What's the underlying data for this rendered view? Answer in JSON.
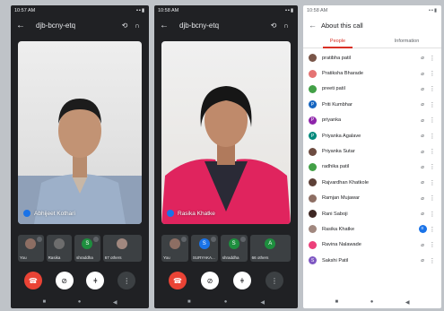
{
  "phone1": {
    "status_time": "10:57 AM",
    "meeting_code": "djb-bcny-etq",
    "speaker": "Abhijeet Kothari",
    "tiles": [
      {
        "label": "You",
        "initial": "",
        "color": "#8d6e63"
      },
      {
        "label": "Rasika",
        "initial": "",
        "color": "#6d6d6d"
      },
      {
        "label": "shraddha",
        "initial": "S",
        "color": "#1e8e3e"
      },
      {
        "label": "67 others",
        "initial": "",
        "color": "#a1887f"
      }
    ]
  },
  "phone2": {
    "status_time": "10:58 AM",
    "meeting_code": "djb-bcny-etq",
    "speaker": "Rasika Khatke",
    "tiles": [
      {
        "label": "You",
        "initial": "",
        "color": "#8d6e63"
      },
      {
        "label": "SURYAKA...",
        "initial": "S",
        "color": "#1a73e8"
      },
      {
        "label": "shraddha",
        "initial": "S",
        "color": "#1e8e3e"
      },
      {
        "label": "66 others",
        "initial": "A",
        "color": "#1e8e3e"
      }
    ]
  },
  "panel": {
    "status_time": "10:58 AM",
    "title": "About this call",
    "tabs": [
      "People",
      "Information"
    ],
    "participants": [
      {
        "name": "pratibha patil",
        "initial": "",
        "color": "#795548",
        "speaking": false
      },
      {
        "name": "Pratiksha Bharade",
        "initial": "",
        "color": "#e57373",
        "speaking": false
      },
      {
        "name": "preeti patil",
        "initial": "",
        "color": "#43a047",
        "speaking": false
      },
      {
        "name": "Priti Kumbhar",
        "initial": "P",
        "color": "#1565c0",
        "speaking": false
      },
      {
        "name": "priyanka",
        "initial": "P",
        "color": "#8e24aa",
        "speaking": false
      },
      {
        "name": "Priyanka Agalave",
        "initial": "P",
        "color": "#00897b",
        "speaking": false
      },
      {
        "name": "Priyanka Sutar",
        "initial": "",
        "color": "#6d4c41",
        "speaking": false
      },
      {
        "name": "radhika patil",
        "initial": "",
        "color": "#43a047",
        "speaking": false
      },
      {
        "name": "Rajvardhan Khatkole",
        "initial": "",
        "color": "#5d4037",
        "speaking": false
      },
      {
        "name": "Ramjan Mujawar",
        "initial": "",
        "color": "#8d6e63",
        "speaking": false
      },
      {
        "name": "Rani Saboji",
        "initial": "",
        "color": "#3e2723",
        "speaking": false
      },
      {
        "name": "Rasika Khatke",
        "initial": "",
        "color": "#a1887f",
        "speaking": true
      },
      {
        "name": "Ravina Nalawade",
        "initial": "",
        "color": "#ec407a",
        "speaking": false
      },
      {
        "name": "Sakshi Patil",
        "initial": "S",
        "color": "#7e57c2",
        "speaking": false
      }
    ]
  }
}
